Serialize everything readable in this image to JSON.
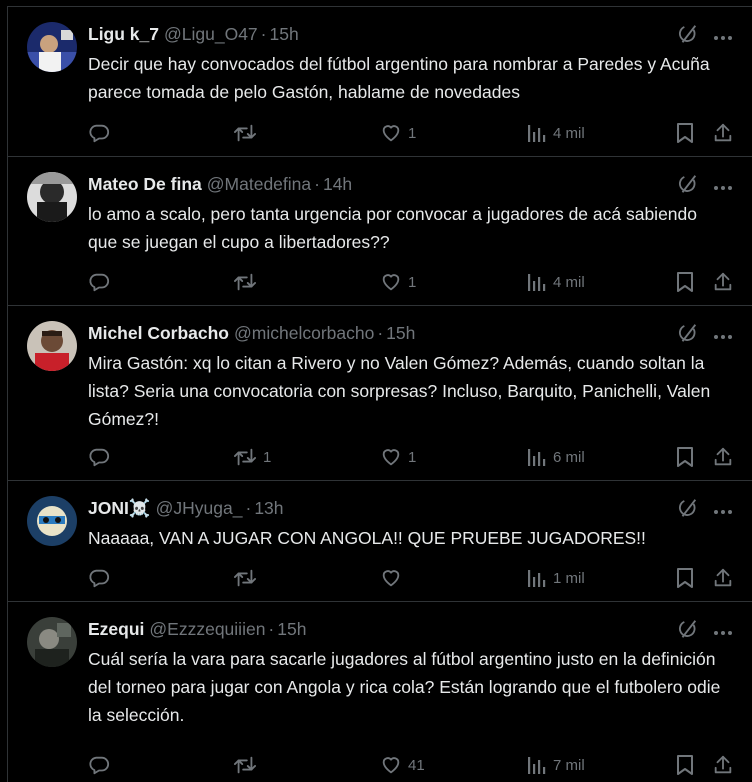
{
  "colors": {
    "background": "#000000",
    "text": "#e7e9ea",
    "secondary": "#71767b",
    "border": "#2f3336"
  },
  "icons": {
    "reply": "reply-icon",
    "retweet": "retweet-icon",
    "like": "heart-icon",
    "views": "views-icon",
    "bookmark": "bookmark-icon",
    "share": "share-icon",
    "grok": "grok-icon",
    "more": "more-icon"
  },
  "tweets": [
    {
      "name": "Ligu k_7",
      "handle": "@Ligu_O47",
      "dot": "·",
      "time": "15h",
      "text": "Decir que hay convocados del fútbol argentino para nombrar a Paredes y Acuña parece tomada de pelo Gastón, hablame de novedades",
      "replies": "",
      "retweets": "",
      "likes": "1",
      "views": "4 mil"
    },
    {
      "name": "Mateo De fina",
      "handle": "@Matedefina",
      "dot": "·",
      "time": "14h",
      "text": "lo amo a scalo, pero tanta urgencia por convocar a jugadores de acá sabiendo que se juegan el cupo a libertadores??",
      "replies": "",
      "retweets": "",
      "likes": "1",
      "views": "4 mil"
    },
    {
      "name": "Michel Corbacho",
      "handle": "@michelcorbacho",
      "dot": "·",
      "time": "15h",
      "text": "Mira Gastón: xq lo citan a Rivero y no Valen Gómez? Además, cuando soltan la lista? Seria una convocatoria con sorpresas? Incluso, Barquito, Panichelli, Valen Gómez?!",
      "replies": "",
      "retweets": "1",
      "likes": "1",
      "views": "6 mil"
    },
    {
      "name": "JONI☠️",
      "handle": "@JHyuga_",
      "dot": "·",
      "time": "13h",
      "text": "Naaaaa, VAN A JUGAR CON ANGOLA!! QUE PRUEBE JUGADORES!!",
      "replies": "",
      "retweets": "",
      "likes": "",
      "views": "1 mil"
    },
    {
      "name": "Ezequi",
      "handle": "@Ezzzequiiien",
      "dot": "·",
      "time": "15h",
      "text": "Cuál sería la vara para sacarle jugadores al fútbol argentino justo en la definición del torneo para jugar con Angola y rica cola? Están logrando que el futbolero odie la selección.",
      "replies": "",
      "retweets": "",
      "likes": "41",
      "views": "7 mil"
    }
  ]
}
